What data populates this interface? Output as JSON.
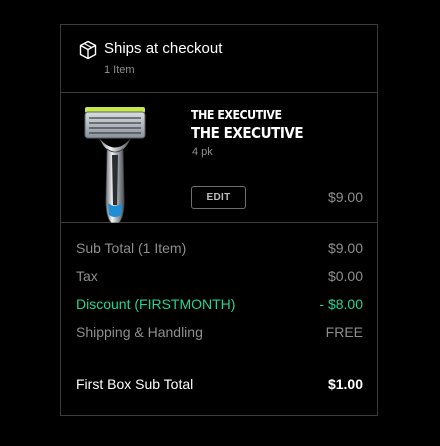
{
  "shipping": {
    "title": "Ships at checkout",
    "item_count": "1 Item",
    "icon": "box-icon"
  },
  "product": {
    "name_line1": "THE EXECUTIVE",
    "name_line2": "THE EXECUTIVE",
    "quantity": "4 pk",
    "edit_label": "EDIT",
    "price": "$9.00",
    "image": "razor-image"
  },
  "summary": {
    "rows": [
      {
        "label": "Sub Total (1 Item)",
        "value": "$9.00"
      },
      {
        "label": "Tax",
        "value": "$0.00"
      },
      {
        "label": "Discount (FIRSTMONTH)",
        "value": "- $8.00"
      },
      {
        "label": "Shipping & Handling",
        "value": "FREE"
      }
    ],
    "total_label": "First Box Sub Total",
    "total_value": "$1.00"
  },
  "colors": {
    "background": "#000000",
    "border": "#3a3a3a",
    "muted_text": "#8e8e8e",
    "discount": "#22d49a",
    "text": "#ffffff"
  }
}
